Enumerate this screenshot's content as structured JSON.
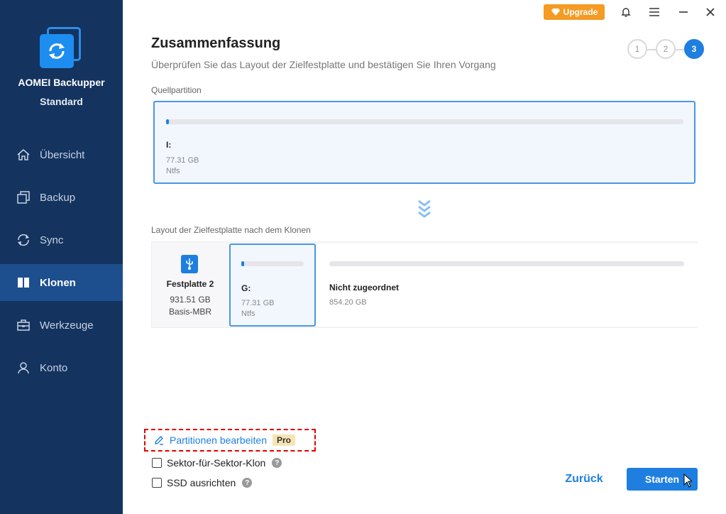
{
  "app": {
    "name": "AOMEI Backupper",
    "edition": "Standard"
  },
  "sidebar": {
    "items": [
      {
        "label": "Übersicht",
        "icon": "home-icon"
      },
      {
        "label": "Backup",
        "icon": "backup-icon"
      },
      {
        "label": "Sync",
        "icon": "sync-icon"
      },
      {
        "label": "Klonen",
        "icon": "clone-icon",
        "active": true
      },
      {
        "label": "Werkzeuge",
        "icon": "tools-icon"
      },
      {
        "label": "Konto",
        "icon": "user-icon"
      }
    ]
  },
  "titlebar": {
    "upgrade_label": "Upgrade"
  },
  "page": {
    "title": "Zusammenfassung",
    "subtitle": "Überprüfen Sie das Layout der Zielfestplatte und bestätigen Sie Ihren Vorgang",
    "steps": [
      "1",
      "2",
      "3"
    ],
    "active_step": 3
  },
  "source": {
    "label": "Quellpartition",
    "partition": {
      "name": "I:",
      "size": "77.31 GB",
      "fs": "Ntfs",
      "used_fraction": 0.005
    }
  },
  "destination": {
    "label": "Layout der Zielfestplatte nach dem Klonen",
    "disk": {
      "name": "Festplatte 2",
      "size": "931.51 GB",
      "type": "Basis-MBR"
    },
    "partition": {
      "name": "G:",
      "size": "77.31 GB",
      "fs": "Ntfs",
      "used_fraction": 0.03
    },
    "unallocated": {
      "name": "Nicht zugeordnet",
      "size": "854.20 GB"
    }
  },
  "options": {
    "edit_partitions": "Partitionen bearbeiten",
    "pro_badge": "Pro",
    "sector_clone": "Sektor-für-Sektor-Klon",
    "ssd_align": "SSD ausrichten"
  },
  "buttons": {
    "back": "Zurück",
    "start": "Starten"
  },
  "colors": {
    "sidebar": "#14335f",
    "sidebar_active": "#1d4f8f",
    "accent": "#1e7fe0",
    "upgrade": "#f59a23"
  }
}
